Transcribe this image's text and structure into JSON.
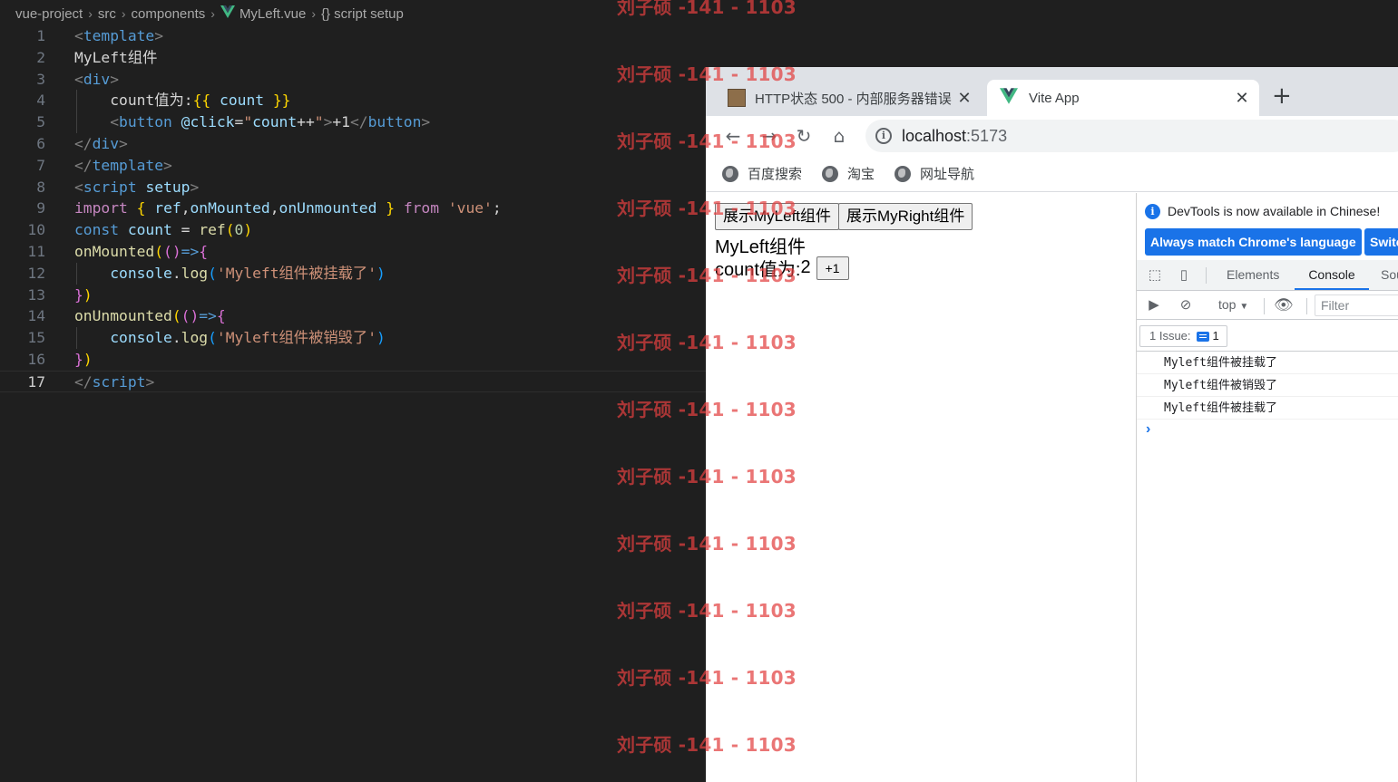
{
  "editor": {
    "breadcrumb": [
      "vue-project",
      "src",
      "components",
      "MyLeft.vue",
      "{} script setup"
    ],
    "current_line": "17"
  },
  "browser": {
    "tabs": [
      {
        "title": "HTTP状态 500 - 内部服务器错误",
        "close": "✕"
      },
      {
        "title": "Vite App",
        "close": "✕"
      }
    ],
    "new_tab": "+",
    "url_host": "localhost",
    "url_port": ":5173",
    "bookmarks": [
      "百度搜索",
      "淘宝",
      "网址导航"
    ]
  },
  "page": {
    "btn_left": "展示MyLeft组件",
    "btn_right": "展示MyRight组件",
    "heading": "MyLeft组件",
    "count_label": "count值为:",
    "count_value": "2",
    "plus_label": "+1"
  },
  "devtools": {
    "notice": "DevTools is now available in Chinese!",
    "btn_match": "Always match Chrome's language",
    "btn_switch": "Switch",
    "tabs": [
      "Elements",
      "Console",
      "Sources"
    ],
    "context": "top",
    "filter_placeholder": "Filter",
    "issues_label": "1 Issue:",
    "issues_count": "1",
    "logs": [
      "Myleft组件被挂载了",
      "Myleft组件被销毁了",
      "Myleft组件被挂载了"
    ],
    "prompt": "›"
  },
  "watermark": "刘子硕 -141 - 1103",
  "colors": {
    "editor_bg": "#1f1f1f",
    "accent_blue": "#1a73e8",
    "watermark": "#e24040"
  }
}
